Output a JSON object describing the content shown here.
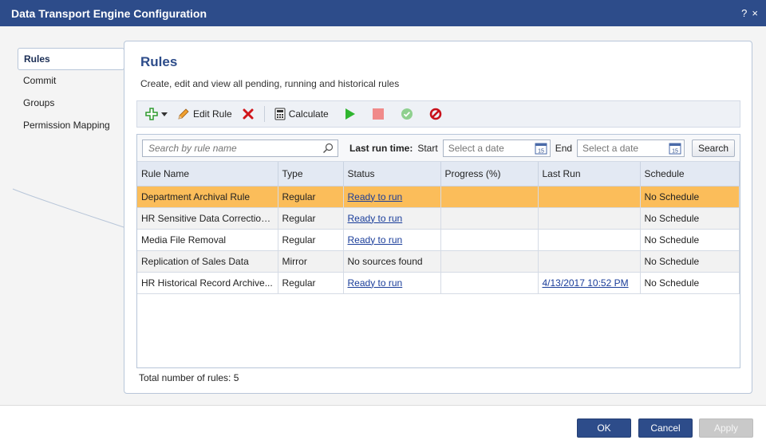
{
  "window": {
    "title": "Data Transport Engine Configuration",
    "help_glyph": "?",
    "close_glyph": "×"
  },
  "sidebar": {
    "items": [
      {
        "label": "Rules",
        "active": true
      },
      {
        "label": "Commit",
        "active": false
      },
      {
        "label": "Groups",
        "active": false
      },
      {
        "label": "Permission Mapping",
        "active": false
      }
    ]
  },
  "main": {
    "title": "Rules",
    "subtitle": "Create, edit and view all pending, running and historical rules"
  },
  "toolbar": {
    "add_icon": "add-plus-icon",
    "edit_label": "Edit Rule",
    "calculate_label": "Calculate",
    "run_icon": "play-icon",
    "stop_icon": "stop-icon",
    "approve_icon": "check-circle-icon",
    "cancel_icon": "no-entry-icon"
  },
  "filter": {
    "search_placeholder": "Search by rule name",
    "last_run_label": "Last run time:",
    "start_label": "Start",
    "start_placeholder": "Select a date",
    "end_label": "End",
    "end_placeholder": "Select a date",
    "calendar_day": "15",
    "search_button": "Search"
  },
  "table": {
    "columns": [
      "Rule Name",
      "Type",
      "Status",
      "Progress (%)",
      "Last Run",
      "Schedule"
    ],
    "rows": [
      {
        "name": "Department Archival Rule",
        "type": "Regular",
        "status": "Ready to run",
        "status_link": true,
        "progress": "",
        "last_run": "",
        "last_run_link": false,
        "schedule": "No Schedule"
      },
      {
        "name": "HR Sensitive Data Correction...",
        "type": "Regular",
        "status": "Ready to run",
        "status_link": true,
        "progress": "",
        "last_run": "",
        "last_run_link": false,
        "schedule": "No Schedule"
      },
      {
        "name": "Media File Removal",
        "type": "Regular",
        "status": "Ready to run",
        "status_link": true,
        "progress": "",
        "last_run": "",
        "last_run_link": false,
        "schedule": "No Schedule"
      },
      {
        "name": "Replication of Sales Data",
        "type": "Mirror",
        "status": "No sources found",
        "status_link": false,
        "progress": "",
        "last_run": "",
        "last_run_link": false,
        "schedule": "No Schedule"
      },
      {
        "name": "HR Historical Record Archive...",
        "type": "Regular",
        "status": "Ready to run",
        "status_link": true,
        "progress": "",
        "last_run": "4/13/2017 10:52 PM",
        "last_run_link": true,
        "schedule": "No Schedule"
      }
    ],
    "total_label": "Total number of rules: 5"
  },
  "footer": {
    "ok": "OK",
    "cancel": "Cancel",
    "apply": "Apply"
  },
  "colors": {
    "titlebar": "#2d4c8a",
    "selected_row": "#fbbd5a",
    "link": "#1a3d9a"
  }
}
